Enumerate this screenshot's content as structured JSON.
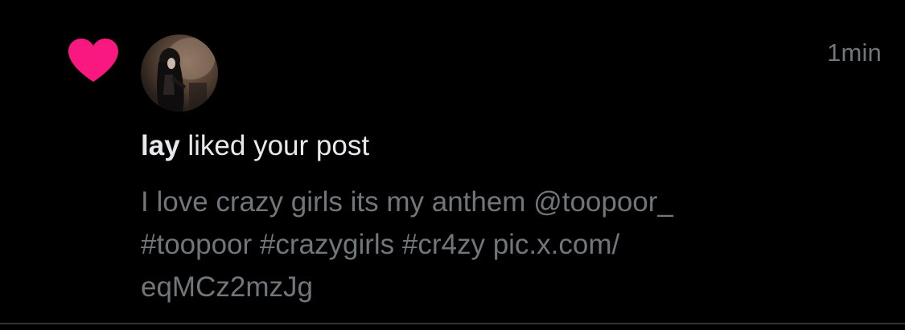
{
  "notification": {
    "type_icon": "heart-icon",
    "icon_color": "#f91880",
    "username": "lay",
    "action_text": " liked your post",
    "timestamp": "1min",
    "post_lines": [
      "I love crazy girls its my anthem @toopoor_",
      "#toopoor #crazygirls #cr4zy pic.x.com/",
      "eqMCz2mzJg"
    ]
  },
  "colors": {
    "background": "#000000",
    "primary_text": "#e7e9ea",
    "secondary_text": "#71767b",
    "like_pink": "#f91880"
  }
}
